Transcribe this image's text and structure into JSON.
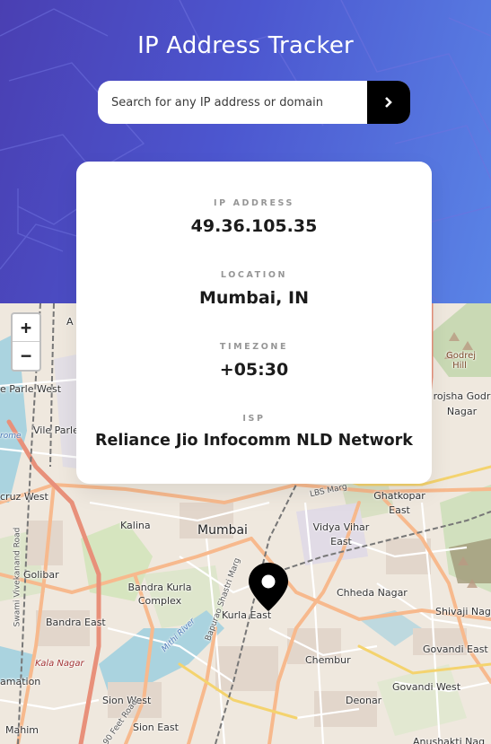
{
  "header": {
    "title": "IP Address Tracker",
    "background_from": "#4a3fb2",
    "background_to": "#5a84e6"
  },
  "search": {
    "placeholder": "Search for any IP address or domain",
    "value": "",
    "submit_icon": "chevron-right-icon"
  },
  "card": {
    "ip": {
      "label": "IP ADDRESS",
      "value": "49.36.105.35"
    },
    "location": {
      "label": "LOCATION",
      "value": "Mumbai, IN"
    },
    "timezone": {
      "label": "TIMEZONE",
      "value": "+05:30"
    },
    "isp": {
      "label": "ISP",
      "value": "Reliance Jio Infocomm NLD Network"
    }
  },
  "map": {
    "zoom_in": "+",
    "zoom_out": "−",
    "marker_icon": "location-pin-icon",
    "labels": {
      "ghatkopar": "Ghatkopar East",
      "mumbai": "Mumbai",
      "vidyavihar": "Vidya Vihar East",
      "kalina": "Kalina",
      "golibar": "Golibar",
      "bkc": "Bandra Kurla Complex",
      "bandra_east": "Bandra East",
      "kurla_east": "Kurla East",
      "chheda": "Chheda Nagar",
      "shivaji": "Shivaji Nag",
      "govandi_e": "Govandi East",
      "govandi_w": "Govandi West",
      "chembur": "Chembur",
      "deonar": "Deonar",
      "sion_w": "Sion West",
      "sion_e": "Sion East",
      "mahim": "Mahim",
      "kala_nagar": "Kala Nagar",
      "parle_w": "e Parle West",
      "vile_parle": "Vile Parle",
      "cruz_w": "cruz West",
      "godrej": "Godrej Hill",
      "frojsha": "rojsha Godr Nagar",
      "lbs": "LBS Marg",
      "sv_road": "Swami Vivekanand Road",
      "mithi": "Mithi River",
      "bsm": "Bapurao Shastri Marg",
      "ninety_feet": "90 Feet Road",
      "amation": "amation",
      "anushakti": "Anushakti Nag",
      "top_a": "A",
      "rome": "rome"
    }
  }
}
